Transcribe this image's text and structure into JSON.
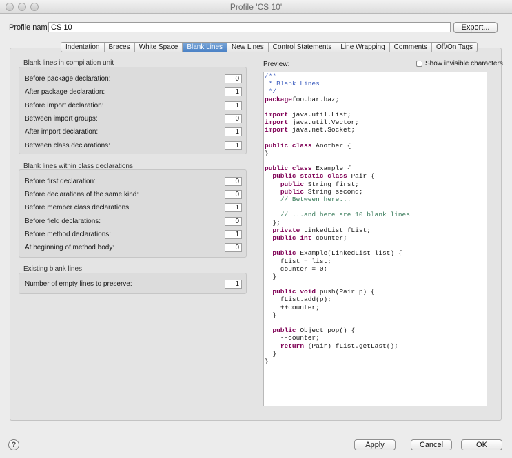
{
  "window": {
    "title": "Profile 'CS 10'"
  },
  "profile": {
    "label": "Profile name:",
    "value": "CS 10",
    "export_label": "Export..."
  },
  "tabs": [
    {
      "label": "Indentation"
    },
    {
      "label": "Braces"
    },
    {
      "label": "White Space"
    },
    {
      "label": "Blank Lines",
      "active": true
    },
    {
      "label": "New Lines"
    },
    {
      "label": "Control Statements"
    },
    {
      "label": "Line Wrapping"
    },
    {
      "label": "Comments"
    },
    {
      "label": "Off/On Tags"
    }
  ],
  "compilation_unit": {
    "title": "Blank lines in compilation unit",
    "rows": [
      {
        "label": "Before package declaration:",
        "value": "0"
      },
      {
        "label": "After package declaration:",
        "value": "1"
      },
      {
        "label": "Before import declaration:",
        "value": "1"
      },
      {
        "label": "Between import groups:",
        "value": "0"
      },
      {
        "label": "After import declaration:",
        "value": "1"
      },
      {
        "label": "Between class declarations:",
        "value": "1"
      }
    ]
  },
  "class_declarations": {
    "title": "Blank lines within class declarations",
    "rows": [
      {
        "label": "Before first declaration:",
        "value": "0"
      },
      {
        "label": "Before declarations of the same kind:",
        "value": "0"
      },
      {
        "label": "Before member class declarations:",
        "value": "1"
      },
      {
        "label": "Before field declarations:",
        "value": "0"
      },
      {
        "label": "Before method declarations:",
        "value": "1"
      },
      {
        "label": "At beginning of method body:",
        "value": "0"
      }
    ]
  },
  "existing": {
    "title": "Existing blank lines",
    "rows": [
      {
        "label": "Number of empty lines to preserve:",
        "value": "1"
      }
    ]
  },
  "preview": {
    "label": "Preview:",
    "show_invisible_label": "Show invisible characters",
    "lines": [
      [
        [
          "dc",
          "/**"
        ]
      ],
      [
        [
          "dc",
          " * Blank Lines"
        ]
      ],
      [
        [
          "dc",
          " */"
        ]
      ],
      [
        [
          "kw",
          "package"
        ],
        [
          "",
          ""
        ],
        [
          "",
          "foo.bar.baz;"
        ]
      ],
      [],
      [
        [
          "kw",
          "import"
        ],
        [
          "",
          "java.util.List;"
        ]
      ],
      [
        [
          "kw",
          "import"
        ],
        [
          "",
          "java.util.Vector;"
        ]
      ],
      [
        [
          "kw",
          "import"
        ],
        [
          "",
          "java.net.Socket;"
        ]
      ],
      [],
      [
        [
          "kw",
          "public class"
        ],
        [
          "",
          "Another {"
        ]
      ],
      [
        [
          "",
          "}"
        ]
      ],
      [],
      [
        [
          "kw",
          "public class"
        ],
        [
          "",
          "Example {"
        ]
      ],
      [
        [
          "",
          "  "
        ],
        [
          "kw",
          "public static class"
        ],
        [
          "",
          "Pair {"
        ]
      ],
      [
        [
          "",
          "    "
        ],
        [
          "kw",
          "public"
        ],
        [
          "",
          "String first;"
        ]
      ],
      [
        [
          "",
          "    "
        ],
        [
          "kw",
          "public"
        ],
        [
          "",
          "String second;"
        ]
      ],
      [
        [
          "",
          "    "
        ],
        [
          "cm",
          "// Between here..."
        ]
      ],
      [],
      [
        [
          "",
          "    "
        ],
        [
          "cm",
          "// ...and here are 10 blank lines"
        ]
      ],
      [
        [
          "",
          "  };"
        ]
      ],
      [
        [
          "",
          "  "
        ],
        [
          "kw",
          "private"
        ],
        [
          "",
          "LinkedList fList;"
        ]
      ],
      [
        [
          "",
          "  "
        ],
        [
          "kw",
          "public int"
        ],
        [
          "",
          "counter;"
        ]
      ],
      [],
      [
        [
          "",
          "  "
        ],
        [
          "kw",
          "public"
        ],
        [
          "",
          "Example(LinkedList list) {"
        ]
      ],
      [
        [
          "",
          "    fList = list;"
        ]
      ],
      [
        [
          "",
          "    counter = 0;"
        ]
      ],
      [
        [
          "",
          "  }"
        ]
      ],
      [],
      [
        [
          "",
          "  "
        ],
        [
          "kw",
          "public void"
        ],
        [
          "",
          "push(Pair p) {"
        ]
      ],
      [
        [
          "",
          "    fList.add(p);"
        ]
      ],
      [
        [
          "",
          "    ++counter;"
        ]
      ],
      [
        [
          "",
          "  }"
        ]
      ],
      [],
      [
        [
          "",
          "  "
        ],
        [
          "kw",
          "public"
        ],
        [
          "",
          "Object pop() {"
        ]
      ],
      [
        [
          "",
          "    --counter;"
        ]
      ],
      [
        [
          "",
          "    "
        ],
        [
          "kw",
          "return"
        ],
        [
          "",
          "(Pair) fList.getLast();"
        ]
      ],
      [
        [
          "",
          "  }"
        ]
      ],
      [
        [
          "",
          "}"
        ]
      ]
    ]
  },
  "footer": {
    "help": "?",
    "apply": "Apply",
    "cancel": "Cancel",
    "ok": "OK"
  }
}
